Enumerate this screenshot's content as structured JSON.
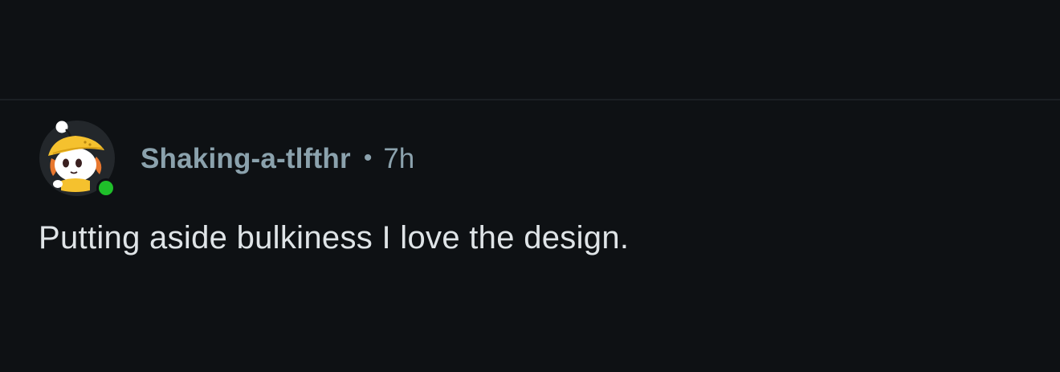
{
  "comment": {
    "username": "Shaking-a-tlfthr",
    "separator": "•",
    "timestamp": "7h",
    "body": "Putting aside bulkiness I love the design.",
    "online": true
  },
  "avatar": {
    "icon": "snoo-avatar-icon",
    "status_icon": "online-status-dot-icon"
  },
  "colors": {
    "background": "#0e1114",
    "divider": "#1b2024",
    "meta_text": "#8ba2ad",
    "body_text": "#dfe4e7",
    "online_dot": "#1fbf2a",
    "hat": "#f5c12e"
  }
}
